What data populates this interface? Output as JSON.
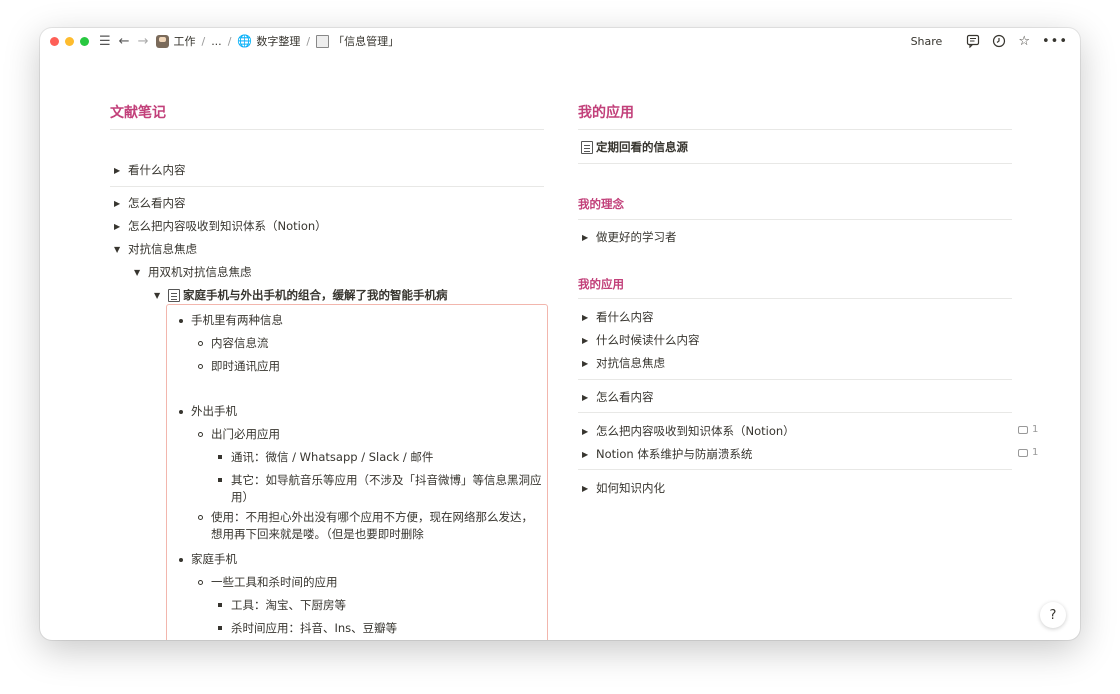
{
  "topbar": {
    "breadcrumbs": [
      "工作",
      "...",
      "数字整理",
      "「信息管理」"
    ],
    "share_label": "Share",
    "icons": [
      "menu-icon",
      "back-arrow-icon",
      "forward-arrow-icon",
      "comment-icon",
      "clock-icon",
      "star-icon",
      "more-icon"
    ]
  },
  "left": {
    "title": "文献笔记",
    "items": [
      {
        "label": "看什么内容",
        "toggle": "▶"
      },
      {
        "label": "怎么看内容",
        "toggle": "▶"
      },
      {
        "label": "怎么把内容吸收到知识体系（Notion）",
        "toggle": "▶"
      },
      {
        "label": "对抗信息焦虑",
        "toggle": "▼"
      },
      {
        "label": "用双机对抗信息焦虑",
        "toggle": "▼"
      },
      {
        "label": "家庭手机与外出手机的组合，缓解了我的智能手机病",
        "toggle": "▼"
      }
    ],
    "callout": [
      "手机里有两种信息",
      "内容信息流",
      "即时通讯应用",
      "外出手机",
      "出门必用应用",
      "通讯：微信 / Whatsapp / Slack / 邮件",
      "其它：如导航音乐等应用（不涉及「抖音微博」等信息黑洞应",
      "用）",
      "使用：不用担心外出没有哪个应用不方便，现在网络那么发达，",
      "想用再下回来就是喽。（但是也要即时删除",
      "家庭手机",
      "一些工具和杀时间的应用",
      "工具：淘宝、下厨房等",
      "杀时间应用：抖音、Ins、豆瓣等"
    ]
  },
  "right": {
    "title": "我的应用",
    "link_page": "定期回看的信息源",
    "sub1": "我的理念",
    "sub1_items": [
      "做更好的学习者"
    ],
    "sub2": "我的应用",
    "sub2_items": [
      "看什么内容",
      "什么时候读什么内容",
      "对抗信息焦虑",
      "怎么看内容",
      "怎么把内容吸收到知识体系（Notion）",
      "Notion 体系维护与防崩溃系统",
      "如何知识内化"
    ],
    "toggle": "▶",
    "comment_counts": [
      "1",
      "1"
    ]
  },
  "help_label": "?"
}
